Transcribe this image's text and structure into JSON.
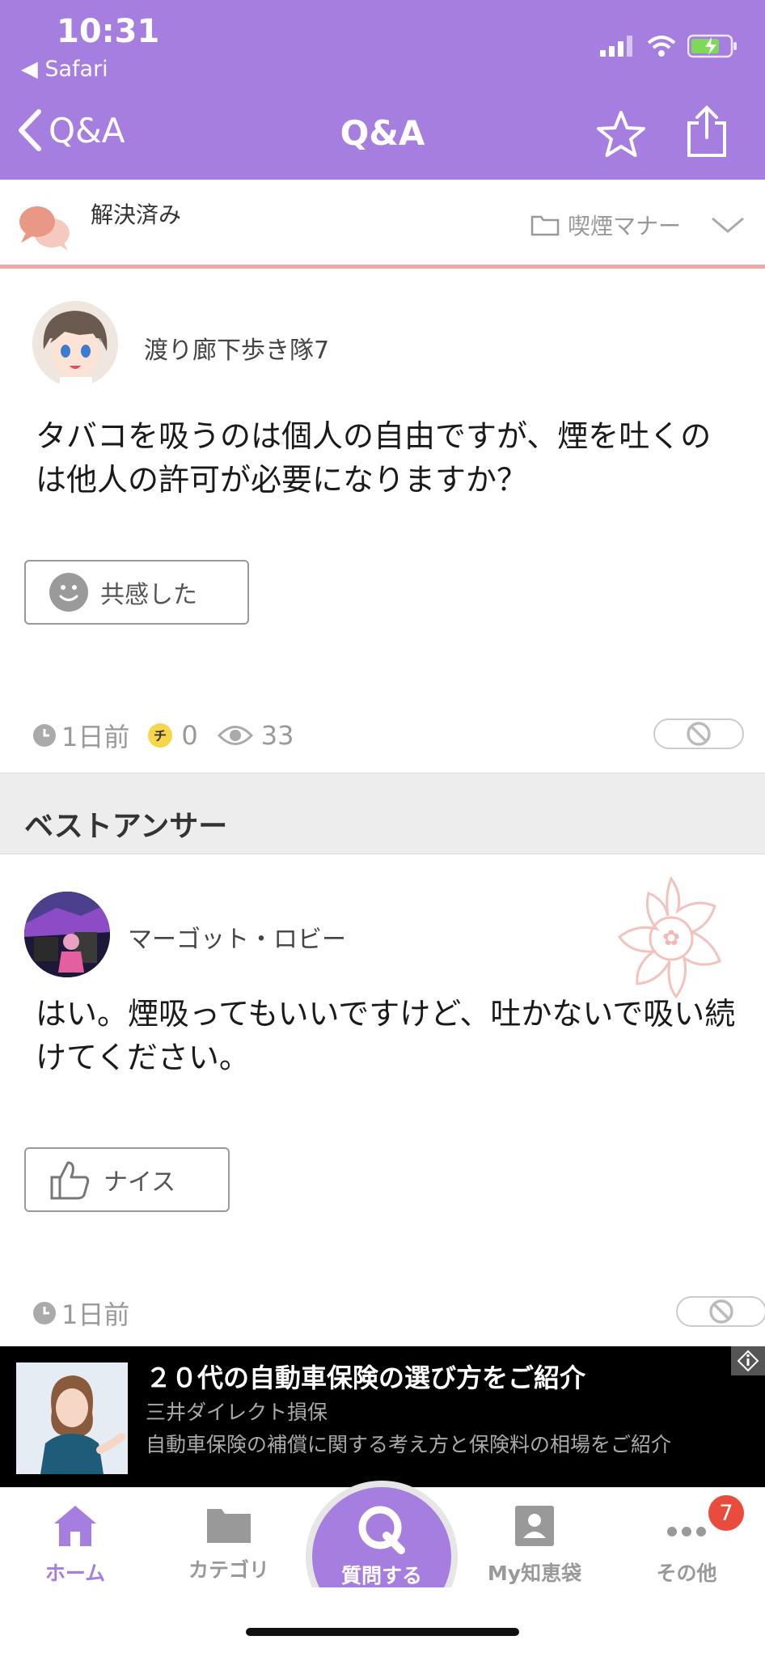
{
  "status_bar": {
    "time": "10:31",
    "back_app": "◀ Safari"
  },
  "nav": {
    "back_label": "Q&A",
    "title": "Q&A"
  },
  "question": {
    "status": "解決済み",
    "category": "喫煙マナー",
    "user": "渡り廊下歩き隊7",
    "text": "タバコを吸うのは個人の自由ですが、煙を吐くのは他人の許可が必要になりますか？",
    "empathy_label": "共感した",
    "posted": "1日前",
    "coins": "0",
    "views": "33"
  },
  "best_answer": {
    "heading": "ベストアンサー",
    "user": "マーゴット・ロビー",
    "text": "はい。煙吸ってもいいですけど、吐かないで吸い続けてください。",
    "nice_label": "ナイス",
    "posted": "1日前"
  },
  "ad": {
    "title": "２０代の自動車保険の選び方をご紹介",
    "sponsor": "三井ダイレクト損保",
    "description": "自動車保険の補償に関する考え方と保険料の相場をご紹介"
  },
  "tabbar": {
    "home": "ホーム",
    "category": "カテゴリ",
    "ask": "質問する",
    "my": "My知恵袋",
    "other": "その他",
    "other_badge": "7"
  },
  "colors": {
    "accent": "#a57ee0",
    "resolved": "#eda9a0",
    "badge": "#e94b3c"
  }
}
